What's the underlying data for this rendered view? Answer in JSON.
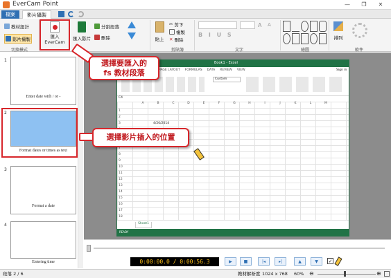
{
  "window": {
    "title": "EverCam Point",
    "controls": [
      "—",
      "❐",
      "✕"
    ]
  },
  "tabs": {
    "file": "檔案",
    "video": "影片攝製"
  },
  "ribbon": {
    "material_design": "教材設計",
    "video_record": "影片攝製",
    "group_switch": "切換模式",
    "import_evercam_1": "匯入",
    "import_evercam_2": "EverCam",
    "import_video": "匯入影片",
    "split_section": "分割段落",
    "delete": "刪除",
    "group_section": "段落",
    "paste": "貼上",
    "cut": "剪下",
    "copy": "複製",
    "remove": "刪除",
    "group_clipboard": "剪貼簿",
    "group_text": "文字",
    "group_drawing": "繪圖",
    "arrange": "排列",
    "group_software": "軟件"
  },
  "callouts": {
    "import_tip_line1": "選擇要匯入的",
    "import_tip_line2": "fs 教材段落",
    "position_tip": "選擇影片插入的位置"
  },
  "slides": [
    {
      "num": "1",
      "caption": "Enter date with / or -"
    },
    {
      "num": "2",
      "caption": "Format dates or times as text"
    },
    {
      "num": "3",
      "caption": "Format a date"
    },
    {
      "num": "4",
      "caption": "Entering time"
    }
  ],
  "excel": {
    "title": "Book1 - Excel",
    "signin": "Sign in",
    "menu": [
      "PAGE LAYOUT",
      "FORMULAS",
      "DATA",
      "REVIEW",
      "VIEW"
    ],
    "cell_ref": "C4",
    "number_format": "Custom",
    "cell_value": "4/20/2014",
    "cols": [
      "A",
      "B",
      "C",
      "D",
      "E",
      "F",
      "G",
      "H",
      "I",
      "J",
      "K",
      "L",
      "M",
      "N",
      "O"
    ],
    "rows": [
      "1",
      "2",
      "3",
      "4",
      "5",
      "6",
      "7",
      "8",
      "9",
      "10",
      "11",
      "12",
      "13",
      "14",
      "15",
      "16",
      "17",
      "18"
    ],
    "sheet": "Sheet1",
    "status": "READY"
  },
  "player": {
    "timecode": "0:00:00.0 / 0:00:56.3"
  },
  "status": {
    "section": "段落 2 / 6",
    "resolution_label": "教材解析度",
    "resolution": "1024 x 768",
    "zoom": "60%"
  },
  "colors": {
    "accent": "#2e6fb3",
    "highlight": "#d7262b",
    "excel_green": "#217346",
    "slide_fill": "#8ec1f2"
  }
}
